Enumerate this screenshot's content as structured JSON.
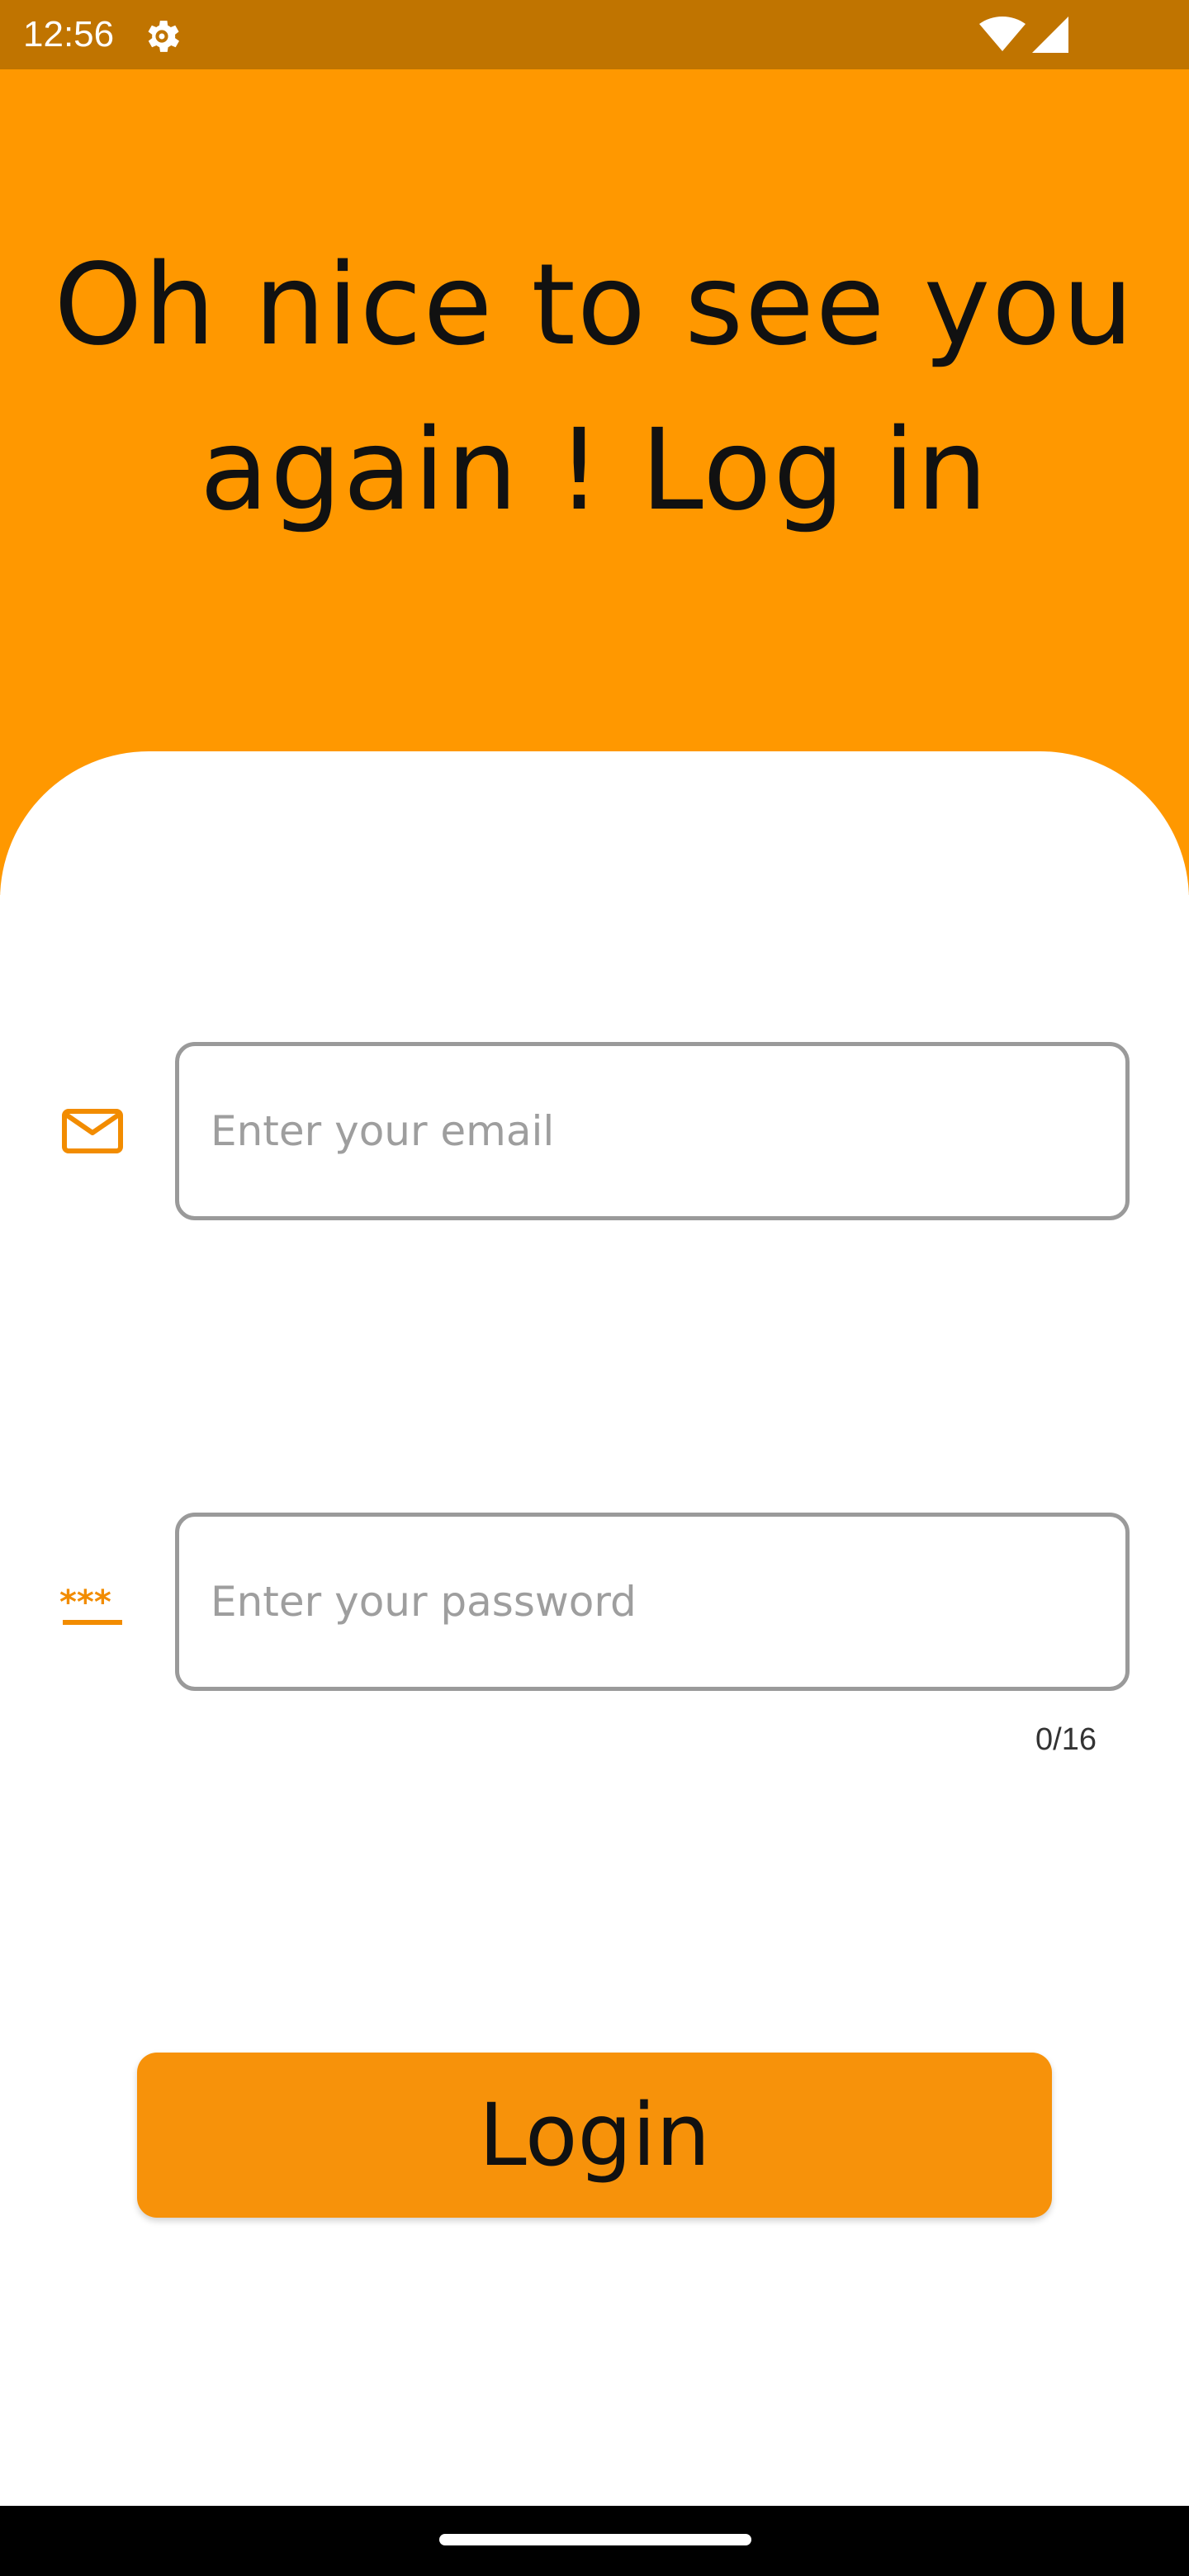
{
  "status_bar": {
    "time": "12:56",
    "icons": [
      "gear-icon",
      "wifi-icon",
      "cellular-signal-icon"
    ]
  },
  "header": {
    "headline": "Oh nice to see you again ! Log in"
  },
  "form": {
    "email": {
      "icon": "mail-icon",
      "placeholder": "Enter your email",
      "value": ""
    },
    "password": {
      "icon": "password-icon",
      "placeholder": "Enter your password",
      "value": "",
      "counter": "0/16"
    },
    "login_label": "Login"
  },
  "colors": {
    "status_bar": "#c07400",
    "header_background": "#ff9800",
    "accent": "#f7920a",
    "input_border": "#9a9a9a",
    "placeholder": "#9e9e9e"
  }
}
